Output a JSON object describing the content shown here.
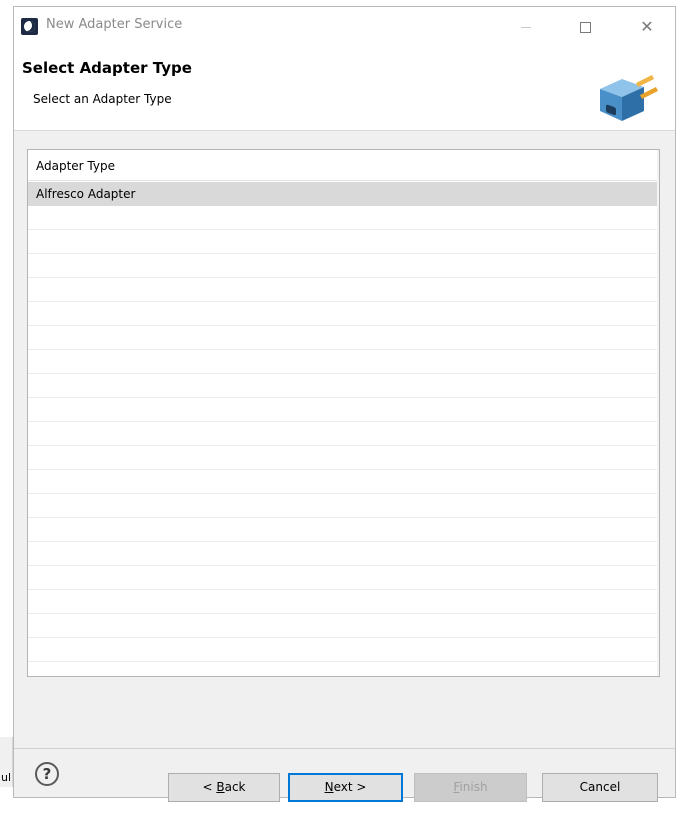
{
  "window": {
    "title": "New Adapter Service",
    "close_glyph": "✕"
  },
  "header": {
    "title": "Select Adapter Type",
    "description": "Select an Adapter Type",
    "icon": "adapter-plug-icon"
  },
  "table": {
    "column_header": "Adapter Type",
    "rows": [
      "Alfresco Adapter"
    ],
    "selected_index": 0
  },
  "background_peek": "ul",
  "buttons": {
    "help": "?",
    "back_prefix": "< ",
    "back_mnemonic": "B",
    "back_rest": "ack",
    "next_mnemonic": "N",
    "next_rest": "ext >",
    "finish_mnemonic": "F",
    "finish_rest": "inish",
    "cancel": "Cancel"
  },
  "colors": {
    "accent": "#0078d7",
    "selected_row": "#d9d9d9",
    "dialog_bg": "#f0f0f0"
  }
}
